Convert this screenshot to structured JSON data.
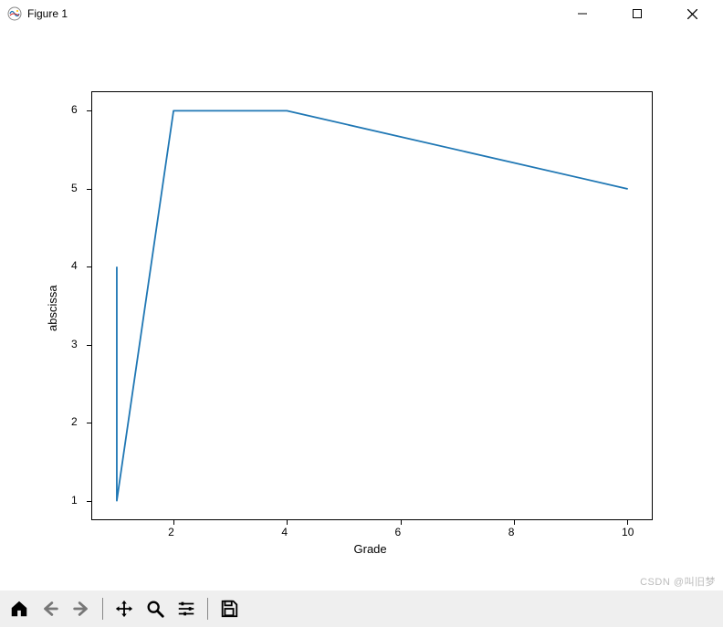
{
  "window": {
    "title": "Figure 1"
  },
  "chart_data": {
    "type": "line",
    "xlabel": "Grade",
    "ylabel": "abscissa",
    "x": [
      1,
      1,
      2,
      4,
      10,
      4
    ],
    "y": [
      4,
      1,
      6,
      6,
      5,
      6
    ],
    "xlim": [
      1,
      10
    ],
    "ylim": [
      1,
      6
    ],
    "xticks": [
      2,
      4,
      6,
      8,
      10
    ],
    "yticks": [
      1,
      2,
      3,
      4,
      5,
      6
    ],
    "line_color": "#1f77b4"
  },
  "toolbar": {
    "home": "Home",
    "back": "Back",
    "forward": "Forward",
    "pan": "Pan",
    "zoom": "Zoom",
    "configure": "Configure subplots",
    "save": "Save"
  },
  "watermark": "CSDN @叫旧梦"
}
